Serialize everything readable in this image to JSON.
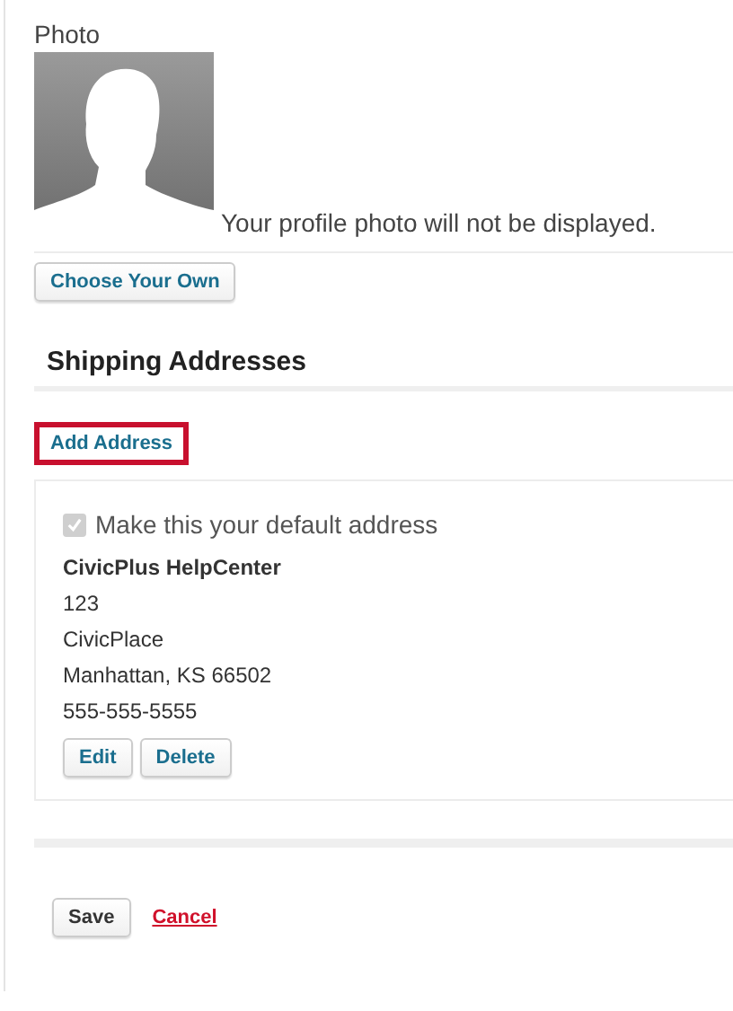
{
  "photo": {
    "label": "Photo",
    "note": "Your profile photo will not be displayed.",
    "button": "Choose Your Own"
  },
  "shipping": {
    "title": "Shipping Addresses",
    "add_button": {
      "label": "Add Address",
      "highlighted": true
    },
    "addresses": [
      {
        "default_label": "Make this your default address",
        "default_checked": true,
        "default_disabled": true,
        "name": "CivicPlus HelpCenter",
        "lines": [
          "123",
          "CivicPlace",
          "Manhattan, KS 66502",
          "555-555-5555"
        ],
        "buttons": [
          "Edit",
          "Delete"
        ]
      }
    ]
  },
  "actions": {
    "save": "Save",
    "cancel": "Cancel"
  }
}
